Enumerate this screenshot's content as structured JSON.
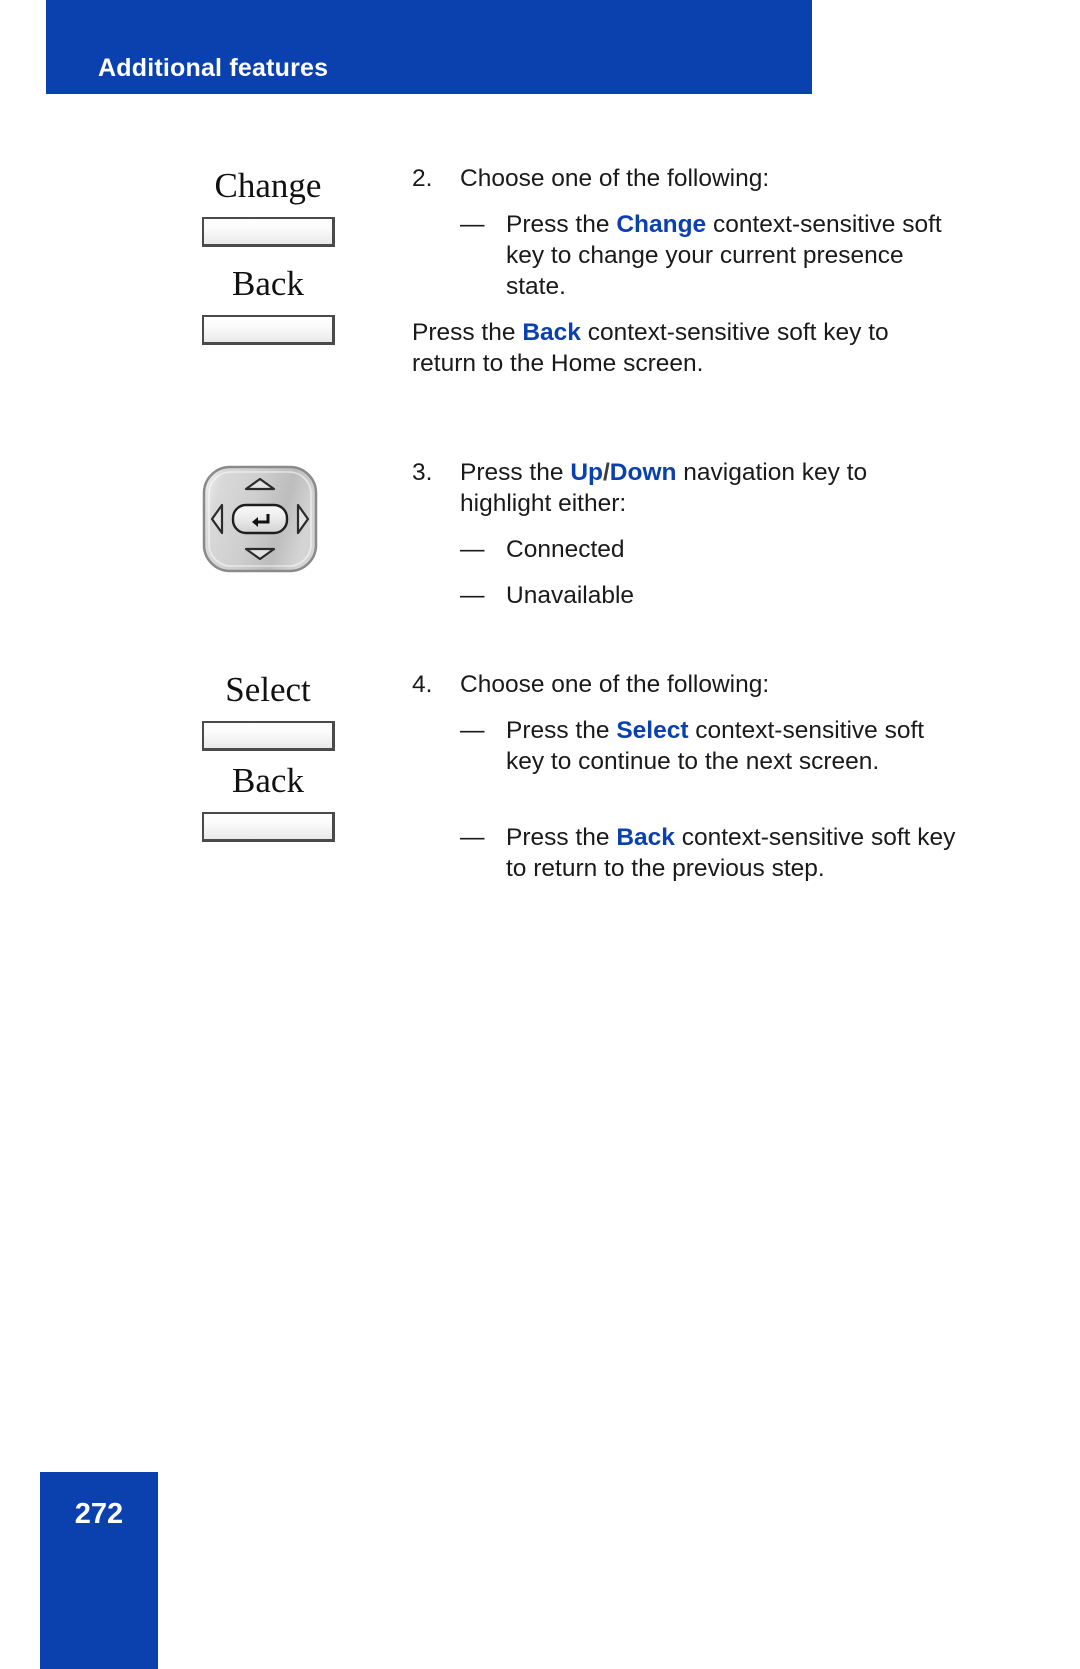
{
  "header": {
    "title": "Additional features",
    "bar_color": "#0A41AE"
  },
  "footer": {
    "page_number": "272",
    "box_color": "#0A41AE"
  },
  "accent_color": "#0A41AE",
  "graphics": [
    {
      "name": "change-softkey",
      "label": "Change"
    },
    {
      "name": "back-softkey-1",
      "label": "Back"
    },
    {
      "name": "navigation-key-cluster",
      "label": ""
    },
    {
      "name": "select-softkey",
      "label": "Select"
    },
    {
      "name": "back-softkey-2",
      "label": "Back"
    }
  ],
  "steps": [
    {
      "number": "2.",
      "text": "Choose one of the following:",
      "bullets": [
        {
          "pre": "Press the ",
          "keyword": "Change",
          "post": " context-sensitive soft key to change your current presence state."
        }
      ]
    },
    {
      "number": "3.",
      "text_pre": "Press the ",
      "keyword_a": "Up",
      "separator": "/",
      "keyword_b": "Down",
      "text_post": " navigation key to highlight either:",
      "bullets": [
        {
          "pre": "",
          "keyword": "",
          "post": "Connected"
        },
        {
          "pre": "",
          "keyword": "",
          "post": "Unavailable"
        }
      ]
    },
    {
      "number": "4.",
      "text": "Choose one of the following:",
      "bullets": [
        {
          "pre": "Press the ",
          "keyword": "Select",
          "post": " context-sensitive soft key to continue to the next screen."
        },
        {
          "pre": "Press the ",
          "keyword": "Back",
          "post": " context-sensitive soft key to return to the previous step."
        }
      ]
    }
  ],
  "paragraphs": [
    {
      "name": "back-home-screen-paragraph",
      "pre": "Press the ",
      "keyword": "Back",
      "post": " context-sensitive soft key to return to the Home screen."
    }
  ],
  "dash": "—"
}
